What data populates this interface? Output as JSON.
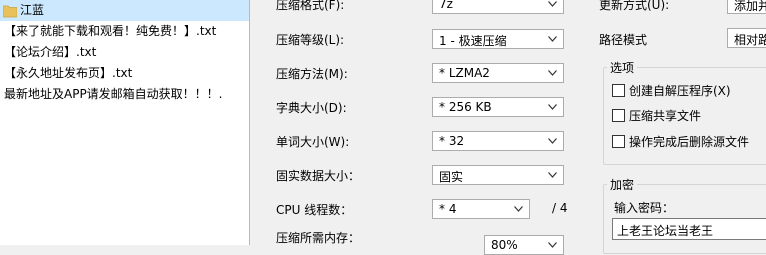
{
  "file_list": {
    "items": [
      {
        "name": "江蓝",
        "type": "folder",
        "selected": true
      },
      {
        "name": "【来了就能下载和观看！纯免费！】.txt",
        "type": "file",
        "selected": false
      },
      {
        "name": "【论坛介绍】.txt",
        "type": "file",
        "selected": false
      },
      {
        "name": "【永久地址发布页】.txt",
        "type": "file",
        "selected": false
      },
      {
        "name": "最新地址及APP请发邮箱自动获取！！！.",
        "type": "file",
        "selected": false
      }
    ]
  },
  "options": {
    "format_label": "压缩格式(F):",
    "format_value": "7z",
    "level_label": "压缩等级(L):",
    "level_value": "1 - 极速压缩",
    "method_label": "压缩方法(M):",
    "method_value": "* LZMA2",
    "dict_label": "字典大小(D):",
    "dict_value": "* 256 KB",
    "word_label": "单词大小(W):",
    "word_value": "* 32",
    "solid_label": "固实数据大小：",
    "solid_value": "固实",
    "cpu_label": "CPU 线程数：",
    "cpu_value": "* 4",
    "cpu_total": "/ 4",
    "memory_label": "压缩所需内存：",
    "memory_value": "80%"
  },
  "right": {
    "update_label": "更新方式(U):",
    "update_value": "添加并",
    "path_label": "路径模式",
    "path_value": "相对路",
    "options_group": "选项",
    "sfx_label": "创建自解压程序(X)",
    "shared_label": "压缩共享文件",
    "delete_label": "操作完成后删除源文件",
    "encrypt_group": "加密",
    "password_label": "输入密码：",
    "password_value": "上老王论坛当老王"
  },
  "colors": {
    "selection": "#cce8ff",
    "folder": "#e8c15a",
    "border": "#acacac"
  }
}
